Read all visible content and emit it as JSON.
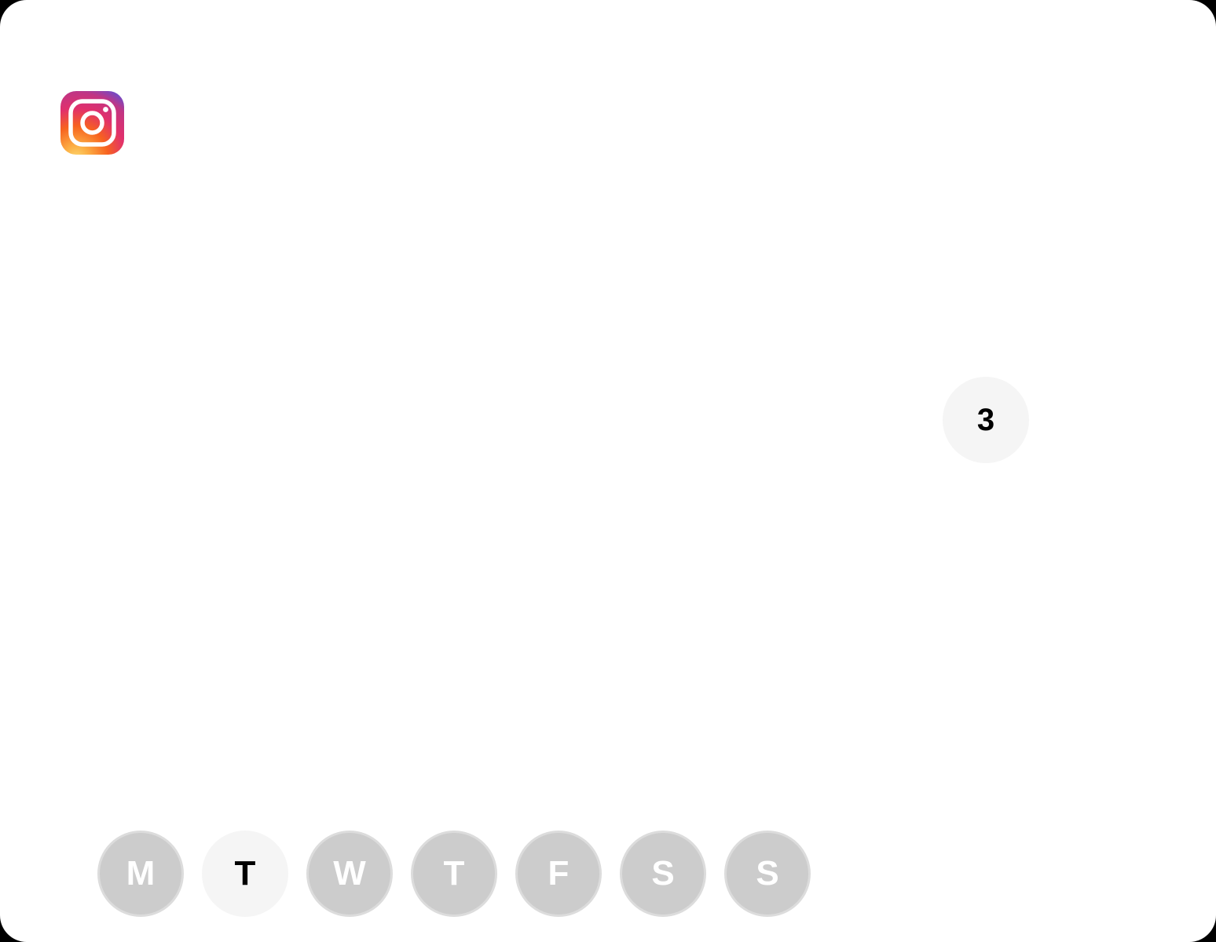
{
  "app": {
    "icon": "instagram-icon"
  },
  "counter": {
    "value": "3"
  },
  "week": {
    "days": [
      {
        "label": "M",
        "active": false
      },
      {
        "label": "T",
        "active": true
      },
      {
        "label": "W",
        "active": false
      },
      {
        "label": "T",
        "active": false
      },
      {
        "label": "F",
        "active": false
      },
      {
        "label": "S",
        "active": false
      },
      {
        "label": "S",
        "active": false
      }
    ]
  },
  "colors": {
    "active_day_bg": "#f5f5f5",
    "inactive_day_bg": "#cccccc",
    "inactive_day_text": "#ffffff",
    "active_day_text": "#000000"
  }
}
